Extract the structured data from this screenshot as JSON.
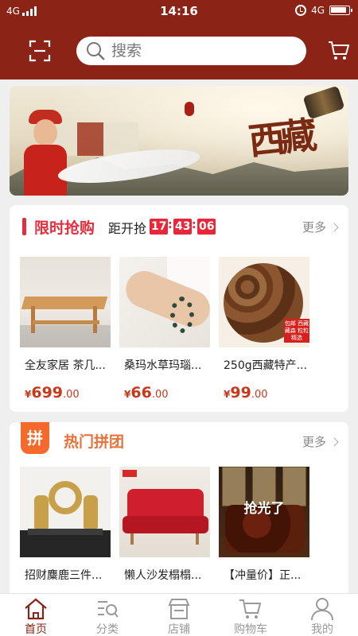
{
  "status": {
    "network": "4G",
    "time": "14:16",
    "network_right": "4G"
  },
  "search": {
    "placeholder": "搜索"
  },
  "icons": {
    "scan": "scan-icon",
    "cart": "cart-icon",
    "search": "search-icon"
  },
  "flash_sale": {
    "title": "限时抢购",
    "countdown_label": "距开抢",
    "hours": "17",
    "minutes": "43",
    "seconds": "06",
    "more": "更多",
    "products": [
      {
        "name": "全友家居 茶几...",
        "currency": "¥",
        "price_int": "699",
        "price_dec": ".00"
      },
      {
        "name": "桑玛水草玛瑙...",
        "currency": "¥",
        "price_int": "66",
        "price_dec": ".00"
      },
      {
        "name": "250g西藏特产...",
        "currency": "¥",
        "price_int": "99",
        "price_dec": ".00",
        "tag": "包邮 西藏藏森 粒粒精选"
      }
    ]
  },
  "group_buy": {
    "badge": "拼",
    "title": "热门拼团",
    "more": "更多",
    "products": [
      {
        "name": "招财麋鹿三件..."
      },
      {
        "name": "懒人沙发榻榻..."
      },
      {
        "name": "【冲量价】正...",
        "overlay": "抢光了"
      }
    ]
  },
  "tabs": [
    {
      "label": "首页",
      "icon": "home-icon",
      "active": true
    },
    {
      "label": "分类",
      "icon": "category-icon",
      "active": false
    },
    {
      "label": "店铺",
      "icon": "shop-icon",
      "active": false
    },
    {
      "label": "购物车",
      "icon": "cart-icon",
      "active": false
    },
    {
      "label": "我的",
      "icon": "profile-icon",
      "active": false
    }
  ],
  "colors": {
    "header": "#8b2416",
    "flash_accent": "#e52e3d",
    "group_accent": "#f56a2c",
    "price": "#c8381b"
  }
}
